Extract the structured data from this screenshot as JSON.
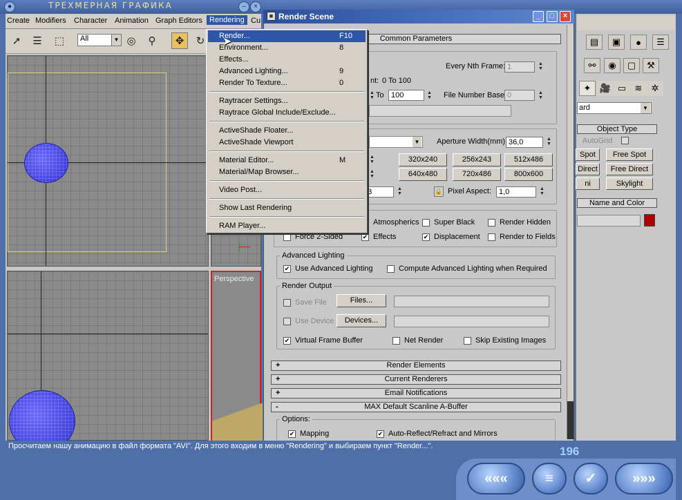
{
  "app_title": "ТРЕХМЕРНАЯ ГРАФИКА",
  "menubar": {
    "items": [
      "Create",
      "Modifiers",
      "Character",
      "Animation",
      "Graph Editors",
      "Rendering",
      "Cu"
    ],
    "active": "Rendering"
  },
  "toolbar": {
    "filter_select": "All"
  },
  "viewports": {
    "perspective_label": "Perspective"
  },
  "rendering_menu": {
    "items": [
      {
        "label": "Render...",
        "shortcut": "F10",
        "selected": true
      },
      {
        "label": "Environment...",
        "shortcut": "8"
      },
      {
        "label": "Effects...",
        "shortcut": ""
      },
      {
        "label": "Advanced Lighting...",
        "shortcut": "9"
      },
      {
        "label": "Render To Texture...",
        "shortcut": "0"
      },
      {
        "label": "Raytracer Settings...",
        "shortcut": ""
      },
      {
        "label": "Raytrace Global Include/Exclude...",
        "shortcut": ""
      },
      {
        "label": "ActiveShade Floater...",
        "shortcut": ""
      },
      {
        "label": "ActiveShade Viewport",
        "shortcut": ""
      },
      {
        "label": "Material Editor...",
        "shortcut": "M"
      },
      {
        "label": "Material/Map Browser...",
        "shortcut": ""
      },
      {
        "label": "Video Post...",
        "shortcut": ""
      },
      {
        "label": "Show Last Rendering",
        "shortcut": ""
      },
      {
        "label": "RAM Player...",
        "shortcut": ""
      }
    ]
  },
  "render_scene": {
    "title": "Render Scene",
    "common_parameters": "Common Parameters",
    "every_nth_frame_label": "Every Nth Frame:",
    "every_nth_frame_value": "1",
    "range_text_tail": "nt:",
    "range_value": "0 To 100",
    "to_label": "To",
    "to_value": "100",
    "file_number_base_label": "File Number Base:",
    "file_number_base_value": "0",
    "aperture_label": "Aperture Width(mm):",
    "aperture_value": "36,0",
    "sizes": [
      "320x240",
      "256x243",
      "512x486",
      "640x480",
      "720x486",
      "800x600"
    ],
    "image_aspect_partial": "33",
    "pixel_aspect_label": "Pixel Aspect:",
    "pixel_aspect_value": "1,0",
    "options": {
      "atmospherics": "Atmospherics",
      "super_black": "Super Black",
      "render_hidden": "Render Hidden",
      "force_2sided": "Force 2-Sided",
      "effects": "Effects",
      "displacement": "Displacement",
      "render_to_fields": "Render to Fields"
    },
    "advanced_lighting": {
      "title": "Advanced Lighting",
      "use": "Use Advanced Lighting",
      "compute": "Compute Advanced Lighting when Required"
    },
    "render_output": {
      "title": "Render Output",
      "save_file": "Save File",
      "files_button": "Files...",
      "use_device": "Use Device",
      "devices_button": "Devices...",
      "virtual_frame_buffer": "Virtual Frame Buffer",
      "net_render": "Net Render",
      "skip_existing": "Skip Existing Images"
    },
    "rollouts": [
      {
        "sign": "+",
        "label": "Render Elements"
      },
      {
        "sign": "+",
        "label": "Current Renderers"
      },
      {
        "sign": "+",
        "label": "Email Notifications"
      },
      {
        "sign": "-",
        "label": "MAX Default Scanline A-Buffer"
      }
    ],
    "scanline_options": {
      "title": "Options:",
      "mapping": "Mapping",
      "auto_reflect": "Auto-Reflect/Refract and Mirrors"
    }
  },
  "command_panel": {
    "category_partial": "ard",
    "object_type_title": "Object Type",
    "autogrid": "AutoGrid",
    "buttons": [
      [
        "Spot",
        "Free Spot"
      ],
      [
        "Direct",
        "Free Direct"
      ],
      [
        "ni",
        "Skylight"
      ]
    ],
    "name_color_title": "Name and Color",
    "color": "#b00000"
  },
  "footer": {
    "caption": "Просчитаем нашу анимацию в файл формата \"AVI\". Для этого входим в меню \"Rendering\" и выбираем пункт \"Render...\".",
    "page_number": "196",
    "nav": [
      "«««",
      "≡",
      "✓",
      "»»»"
    ]
  }
}
